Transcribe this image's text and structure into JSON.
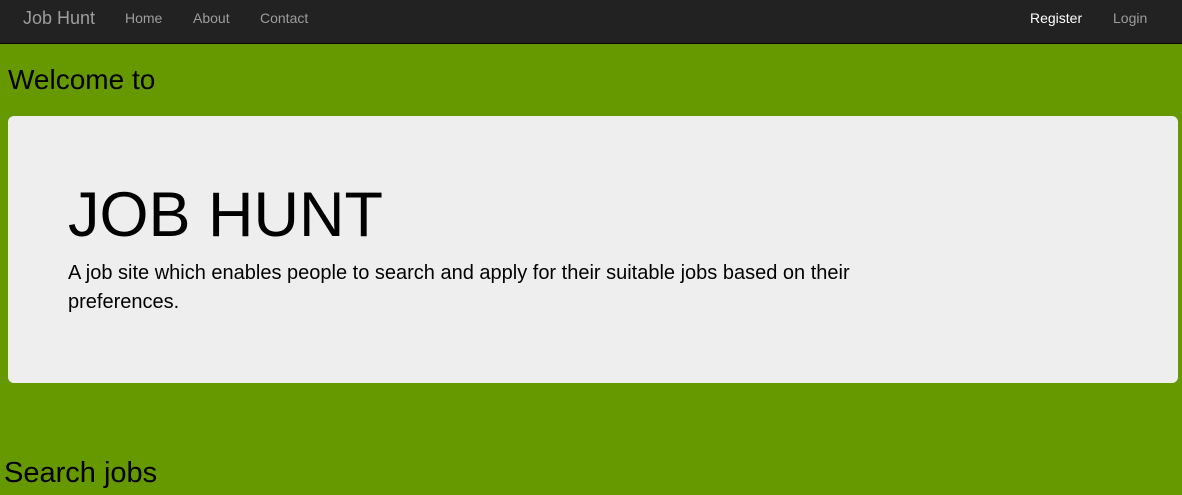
{
  "navbar": {
    "brand": "Job Hunt",
    "links": [
      {
        "label": "Home"
      },
      {
        "label": "About"
      },
      {
        "label": "Contact"
      }
    ],
    "right_links": [
      {
        "label": "Register"
      },
      {
        "label": "Login"
      }
    ]
  },
  "main": {
    "welcome": "Welcome to",
    "jumbotron": {
      "title": "JOB HUNT",
      "description": "A job site which enables people to search and apply for their suitable jobs based on their preferences."
    },
    "search_heading": "Search jobs"
  },
  "colors": {
    "page_background": "#669900",
    "navbar_background": "#222222",
    "jumbotron_background": "#eeeeee",
    "nav_link": "#9d9d9d",
    "nav_link_active": "#ffffff"
  }
}
